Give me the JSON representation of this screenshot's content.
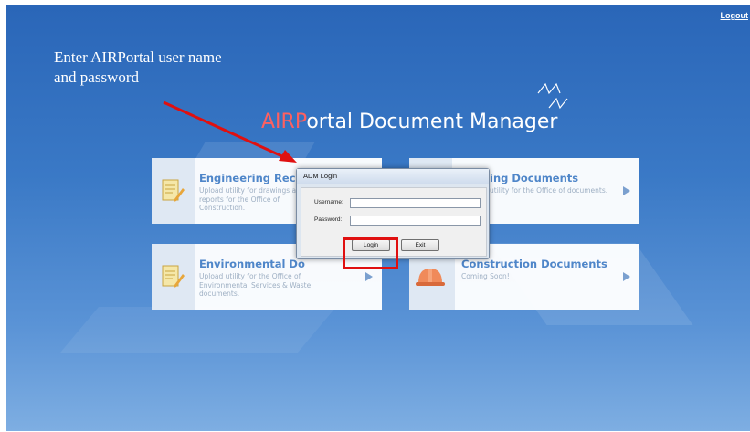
{
  "header": {
    "logout_label": "Logout"
  },
  "annotation": {
    "line1": "Enter AIRPortal user name",
    "line2": "and password"
  },
  "app": {
    "title_accent": "AIRP",
    "title_rest": "ortal Document Manager"
  },
  "tiles": [
    {
      "title": "Engineering Recon",
      "desc": "Upload utility for drawings and reports for the Office of Construction.",
      "icon": "document-pencil-icon"
    },
    {
      "title": "ing Documents",
      "desc": "utility for the Office of documents.",
      "icon": "document-icon"
    },
    {
      "title": "Environmental Do",
      "desc": "Upload utility for the Office of Environmental Services & Waste documents.",
      "icon": "document-pencil-icon"
    },
    {
      "title": "Construction Documents",
      "desc": "Coming Soon!",
      "icon": "hard-hat-icon"
    }
  ],
  "dialog": {
    "title": "ADM Login",
    "username_label": "Username:",
    "username_value": "",
    "password_label": "Password:",
    "password_value": "",
    "login_label": "Login",
    "exit_label": "Exit"
  },
  "colors": {
    "background": "#2a66b8",
    "accent": "#ff6060",
    "tile_title": "#4f86c9",
    "highlight": "#e01010"
  }
}
